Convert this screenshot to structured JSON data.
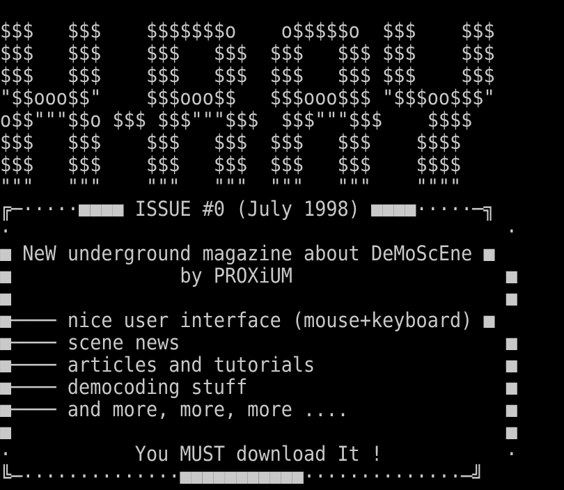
{
  "banner": [
    "$$$   $$$    $$$$$$$o    o$$$$$o  $$$    $$$",
    "$$$   $$$    $$$   $$$  $$$   $$$ $$$    $$$",
    "$$$   $$$    $$$   $$$  $$$   $$$ $$$    $$$",
    "\"$$ooo$$\"    $$$ooo$$   $$$ooo$$$ \"$$$oo$$$\"",
    "o$$\"\"\"$$o $$$ $$$\"\"\"$$$  $$$\"\"\"$$$    $$$$",
    "$$$   $$$    $$$   $$$  $$$   $$$    $$$$",
    "$$$   $$$    $$$   $$$  $$$   $$$    $$$$",
    "\"\"\"   \"\"\"    \"\"\"   \"\"\"  \"\"\"   \"\"\"    \"\"\"\""
  ],
  "box": {
    "top_border": "╔─·····■■■■ ISSUE #0 (July 1998) ■■■■·····─╗",
    "rows": [
      "·                                            ·",
      "■ NeW underground magazine about DeMoScEne ■",
      "■               by PROXiUM                   ■",
      "■                                            ■",
      "■──── nice user interface (mouse+keyboard) ■",
      "■──── scene news                             ■",
      "■──── articles and tutorials                 ■",
      "■──── democoding stuff                       ■",
      "■──── and more, more, more ....              ■",
      "■                                            ■",
      "·           You MUST download It !           ·"
    ],
    "bottom_border": "╚─··············■■■■■■■■■■■··············─╝"
  },
  "colors": {
    "background": "#000000",
    "text": "#c6c6c6"
  }
}
